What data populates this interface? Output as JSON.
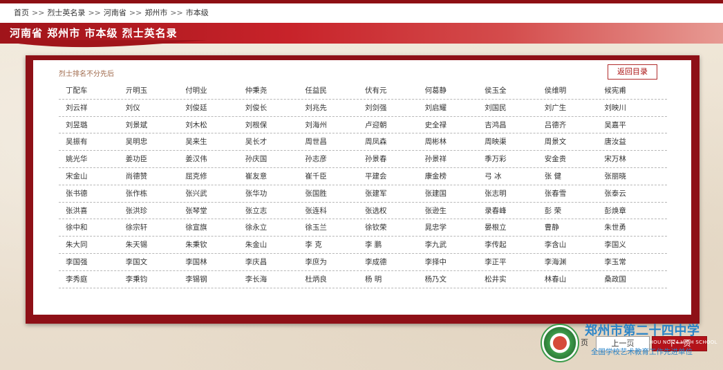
{
  "breadcrumb": {
    "items": [
      "首页",
      "烈士英名录",
      "河南省",
      "郑州市",
      "市本级"
    ],
    "separator": ">>"
  },
  "banner": {
    "title": "河南省 郑州市 市本级 烈士英名录"
  },
  "card": {
    "note": "烈士排名不分先后",
    "return_label": "返回目录"
  },
  "names": [
    [
      "丁配车",
      "亓明玉",
      "付明业",
      "仲秉尧",
      "任益民",
      "伏有元",
      "何葛静",
      "侯玉全",
      "侯维明",
      "候宪甫"
    ],
    [
      "刘云祥",
      "刘仪",
      "刘俊廷",
      "刘俊长",
      "刘兆先",
      "刘剑强",
      "刘启耀",
      "刘国民",
      "刘广生",
      "刘映川"
    ],
    [
      "刘昱璐",
      "刘景斌",
      "刘木松",
      "刘根保",
      "刘海州",
      "卢迎朝",
      "史全禄",
      "吉鸿昌",
      "吕德齐",
      "吴嘉平"
    ],
    [
      "吴振有",
      "吴明忠",
      "吴来生",
      "吴长才",
      "周世昌",
      "周凤森",
      "周彬林",
      "周映渠",
      "周景文",
      "唐汝益"
    ],
    [
      "姚光华",
      "姜功臣",
      "姜汉伟",
      "孙庆国",
      "孙志彦",
      "孙景春",
      "孙景祥",
      "季万彩",
      "安金贵",
      "宋万林"
    ],
    [
      "宋金山",
      "尚德赞",
      "屈克修",
      "崔友意",
      "崔千臣",
      "平建会",
      "康金榜",
      "弓 冰",
      "张 健",
      "张丽晓"
    ],
    [
      "张书德",
      "张作栋",
      "张兴武",
      "张华功",
      "张国胜",
      "张建军",
      "张建国",
      "张志明",
      "张春雪",
      "张泰云"
    ],
    [
      "张洪喜",
      "张洪珍",
      "张琴堂",
      "张立志",
      "张连科",
      "张选权",
      "张逊生",
      "录春峰",
      "彭 荣",
      "彭焕章"
    ],
    [
      "徐中和",
      "徐宗轩",
      "徐宣旗",
      "徐永立",
      "徐玉兰",
      "徐钦荣",
      "晁忠学",
      "晏根立",
      "曹静",
      "朱世勇"
    ],
    [
      "朱大同",
      "朱天锡",
      "朱秉钦",
      "朱金山",
      "李 克",
      "李 鹏",
      "李九武",
      "李传起",
      "李含山",
      "李国义"
    ],
    [
      "李国强",
      "李国文",
      "李国林",
      "李庆昌",
      "李庶为",
      "李成德",
      "李择中",
      "李正平",
      "李海渊",
      "李玉常"
    ],
    [
      "李秀庭",
      "李秉钧",
      "李锡钢",
      "李长海",
      "杜炳良",
      "杨 明",
      "杨乃文",
      "松井实",
      "林春山",
      "桑政国"
    ]
  ],
  "pagination": {
    "label": "页",
    "prev_label": "上一页",
    "next_label": "下一页"
  },
  "watermark": {
    "title": "郑州市第二十四中学",
    "english": "ZHENGZHOU NO.24 HIGH SCHOOL",
    "subtitle": "全国学校艺术教育工作先进单位"
  },
  "colors": {
    "brand_red": "#b3131a",
    "frame_red": "#8e1017",
    "watermark_blue": "#2a84c8"
  }
}
